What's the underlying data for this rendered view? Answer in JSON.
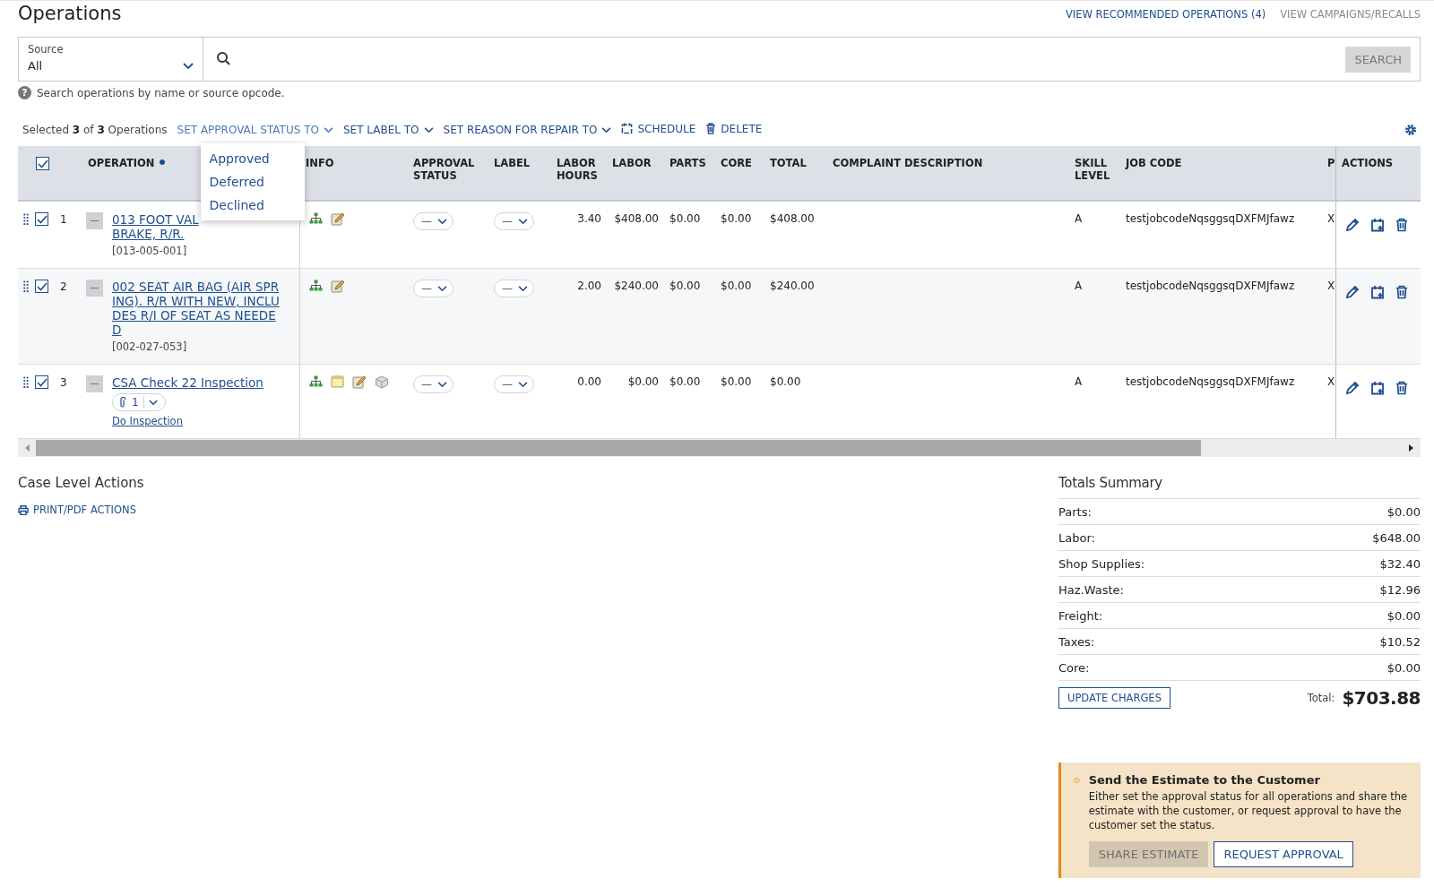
{
  "title": "Operations",
  "top_links": [
    {
      "label": "VIEW RECOMMENDED OPERATIONS (4)",
      "disabled": false
    },
    {
      "label": "VIEW CAMPAIGNS/RECALLS",
      "disabled": true
    }
  ],
  "search": {
    "source_label": "Source",
    "source_value": "All",
    "button": "SEARCH",
    "button_disabled": true,
    "help_glyph": "?",
    "help": "Search operations by name or source opcode."
  },
  "toolbar": {
    "selected": "Selected **3** of **3** Operations",
    "actions": [
      {
        "kind": "dropdown",
        "label": "SET APPROVAL STATUS TO",
        "open": true,
        "menu": [
          "Approved",
          "Deferred",
          "Declined"
        ]
      },
      {
        "kind": "dropdown",
        "label": "SET LABEL TO"
      },
      {
        "kind": "dropdown",
        "label": "SET REASON FOR REPAIR TO"
      },
      {
        "kind": "schedule",
        "label": "SCHEDULE"
      },
      {
        "kind": "delete",
        "label": "DELETE"
      }
    ]
  },
  "table": {
    "all_checked": true,
    "columns": [
      {
        "label": "OPERATION",
        "marked": true
      },
      {
        "label": "INFO"
      },
      {
        "label": "APPROVAL STATUS"
      },
      {
        "label": "LABEL"
      },
      {
        "label": "LABOR HOURS"
      },
      {
        "label": "LABOR"
      },
      {
        "label": "PARTS"
      },
      {
        "label": "CORE"
      },
      {
        "label": "TOTAL"
      },
      {
        "label": "COMPLAINT DESCRIPTION"
      },
      {
        "label": "SKILL LEVEL"
      },
      {
        "label": "JOB CODE"
      },
      {
        "label": "P"
      },
      {
        "label": "ACTIONS"
      }
    ],
    "rows": [
      {
        "number": "1",
        "checked": true,
        "name": "013 FOOT VAL\nBRAKE, R/R.",
        "code": "[013-005-001]",
        "info_icons": [
          {
            "kind": "hierarchy"
          },
          {
            "kind": "edit-note"
          }
        ],
        "approval_status": "—",
        "label": "—",
        "labor_hours": "3.40",
        "labor": "$408.00",
        "parts": "$0.00",
        "core": "$0.00",
        "total": "$408.00",
        "skill_level": "A",
        "job_code": "testjobcodeNqsggsqDXFMJfawz",
        "column_p": "X"
      },
      {
        "number": "2",
        "checked": true,
        "name": "002 SEAT AIR BAG (AIR SPRING). R/R WITH NEW, INCLUDES R/I OF SEAT AS NEEDED",
        "code": "[002-027-053]",
        "info_icons": [
          {
            "kind": "hierarchy"
          },
          {
            "kind": "edit-note"
          }
        ],
        "approval_status": "—",
        "label": "—",
        "labor_hours": "2.00",
        "labor": "$240.00",
        "parts": "$0.00",
        "core": "$0.00",
        "total": "$240.00",
        "skill_level": "A",
        "job_code": "testjobcodeNqsggsqDXFMJfawz",
        "column_p": "X"
      },
      {
        "number": "3",
        "checked": true,
        "name": "CSA Check 22 Inspection",
        "attachments": "1",
        "link": "Do Inspection",
        "info_icons": [
          {
            "kind": "hierarchy"
          },
          {
            "kind": "note"
          },
          {
            "kind": "edit-note"
          },
          {
            "kind": "part"
          }
        ],
        "approval_status": "—",
        "label": "—",
        "labor_hours": "0.00",
        "labor": "$0.00",
        "parts": "$0.00",
        "core": "$0.00",
        "total": "$0.00",
        "skill_level": "A",
        "job_code": "testjobcodeNqsggsqDXFMJfawz",
        "column_p": "X"
      }
    ]
  },
  "case_actions": {
    "title": "Case Level Actions",
    "print": "PRINT/PDF ACTIONS"
  },
  "totals": {
    "title": "Totals Summary",
    "rows": [
      {
        "label": "Parts:",
        "value": "$0.00"
      },
      {
        "label": "Labor:",
        "value": "$648.00"
      },
      {
        "label": "Shop Supplies:",
        "value": "$32.40"
      },
      {
        "label": "Haz.Waste:",
        "value": "$12.96"
      },
      {
        "label": "Freight:",
        "value": "$0.00"
      },
      {
        "label": "Taxes:",
        "value": "$10.52"
      },
      {
        "label": "Core:",
        "value": "$0.00"
      }
    ],
    "update_button": "UPDATE CHARGES",
    "total_label": "Total:",
    "total_value": "$703.88"
  },
  "notice": {
    "title": "Send the Estimate to the Customer",
    "text": "Either set the approval status for all operations and share the estimate with the customer, or request approval to have the customer set the status.",
    "buttons": [
      {
        "label": "SHARE ESTIMATE",
        "disabled": true
      },
      {
        "label": "REQUEST APPROVAL",
        "disabled": false
      }
    ]
  }
}
